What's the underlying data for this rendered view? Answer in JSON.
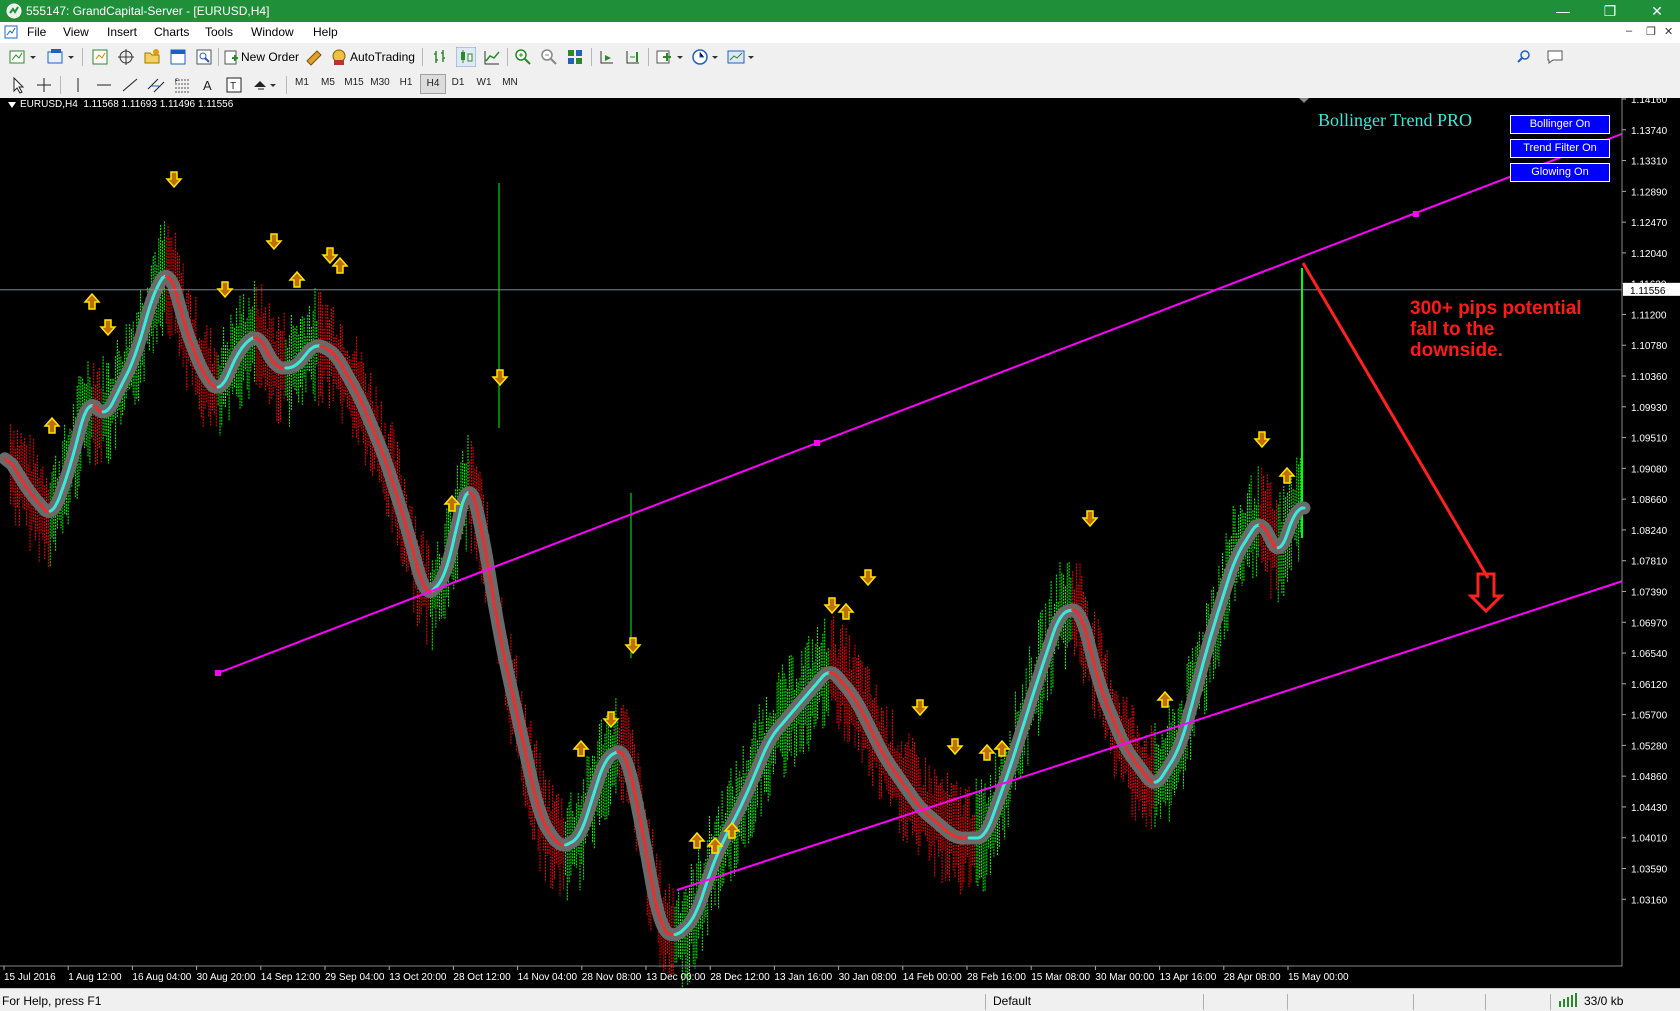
{
  "window": {
    "title": "555147: GrandCapital-Server - [EURUSD,H4]",
    "minimize": "—",
    "restore": "❐",
    "close": "✕"
  },
  "menu": [
    "File",
    "View",
    "Insert",
    "Charts",
    "Tools",
    "Window",
    "Help"
  ],
  "toolbar": {
    "new_order_label": "New Order",
    "autotrading_label": "AutoTrading"
  },
  "timeframes": [
    "M1",
    "M5",
    "M15",
    "M30",
    "H1",
    "H4",
    "D1",
    "W1",
    "MN"
  ],
  "active_timeframe": "H4",
  "chart": {
    "header": "EURUSD,H4  1.11568 1.11693 1.11496 1.11556",
    "indicator_title": "Bollinger Trend PRO",
    "current_price_label": "1.11556",
    "annotation_lines": [
      "300+ pips potential",
      "fall to the",
      "downside."
    ],
    "buttons": [
      "Bollinger On",
      "Trend Filter On",
      "Glowing On"
    ],
    "price_axis": [
      "1.14160",
      "1.13740",
      "1.13310",
      "1.12890",
      "1.12470",
      "1.12040",
      "1.11620",
      "1.11200",
      "1.10780",
      "1.10360",
      "1.09930",
      "1.09510",
      "1.09080",
      "1.08660",
      "1.08240",
      "1.07810",
      "1.07390",
      "1.06970",
      "1.06540",
      "1.06120",
      "1.05700",
      "1.05280",
      "1.04860",
      "1.04430",
      "1.04010",
      "1.03590",
      "1.03160"
    ],
    "time_axis": [
      "15 Jul 2016",
      "1 Aug 12:00",
      "16 Aug 04:00",
      "30 Aug 20:00",
      "14 Sep 12:00",
      "29 Sep 04:00",
      "13 Oct 20:00",
      "28 Oct 12:00",
      "14 Nov 04:00",
      "28 Nov 08:00",
      "13 Dec 00:00",
      "28 Dec 12:00",
      "13 Jan 16:00",
      "30 Jan 08:00",
      "14 Feb 00:00",
      "28 Feb 16:00",
      "15 Mar 08:00",
      "30 Mar 00:00",
      "13 Apr 16:00",
      "28 Apr 08:00",
      "15 May 00:00"
    ],
    "colors": {
      "background": "#000000",
      "bull": "#00ff00",
      "bear": "#ff0000",
      "trend_up": "#3ce8d8",
      "trend_down": "#e83030",
      "channel": "#ff00ff",
      "arrow": "#ff2020",
      "signal": "#ffe600",
      "indicator_title": "#3ce8d8"
    }
  },
  "status": {
    "help": "For Help, press F1",
    "profile": "Default",
    "traffic": "33/0 kb"
  }
}
